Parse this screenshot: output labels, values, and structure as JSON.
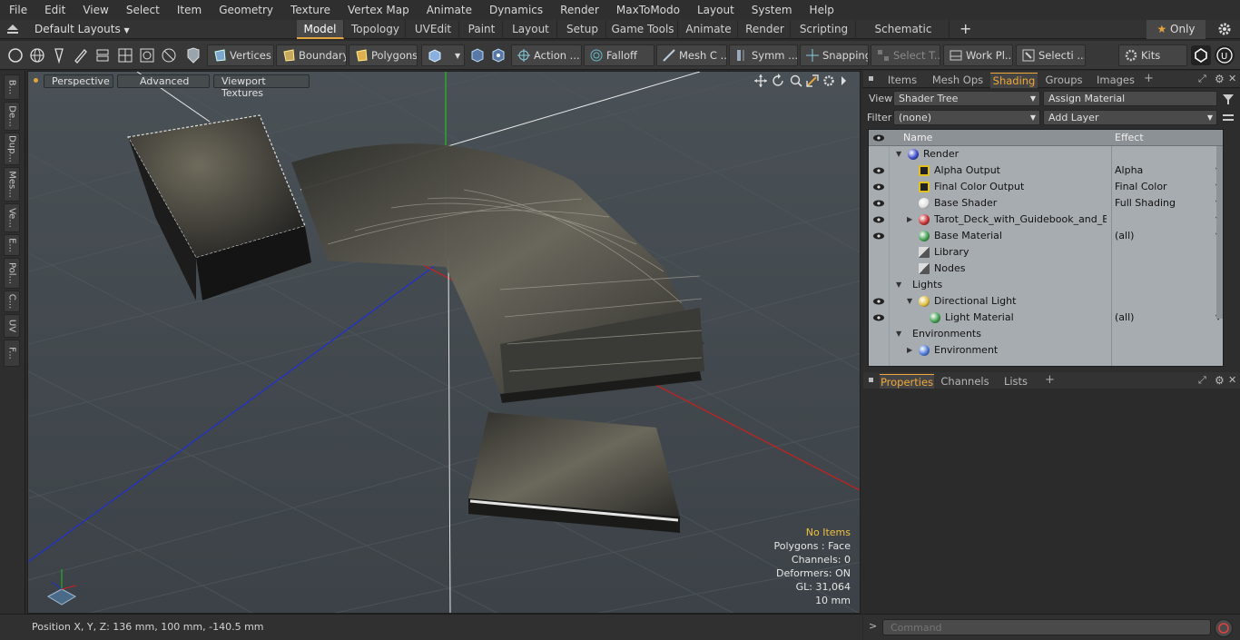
{
  "menubar": {
    "items": [
      "File",
      "Edit",
      "View",
      "Select",
      "Item",
      "Geometry",
      "Texture",
      "Vertex Map",
      "Animate",
      "Dynamics",
      "Render",
      "MaxToModo",
      "Layout",
      "System",
      "Help"
    ]
  },
  "layoutbar": {
    "layout_selector": "Default Layouts",
    "tabs": [
      "Model",
      "Topology",
      "UVEdit",
      "Paint",
      "Layout",
      "Setup",
      "Game Tools",
      "Animate",
      "Render",
      "Scripting",
      "Schematic Fusion"
    ],
    "active_tab": "Model",
    "only_label": "Only"
  },
  "toolbar": {
    "vertices": "Vertices",
    "boundary": "Boundary",
    "polygons": "Polygons",
    "action": "Action ...",
    "falloff": "Falloff",
    "meshc": "Mesh C ...",
    "symm": "Symm ...",
    "snapping": "Snapping",
    "selectt": "Select T...",
    "workpl": "Work Pl...",
    "selecti": "Selecti ...",
    "kits": "Kits"
  },
  "leftstrip": {
    "tabs": [
      "B...",
      "De...",
      "Dup...",
      "Mes...",
      "Ve...",
      "E...",
      "Pol...",
      "C...",
      "UV",
      "F..."
    ]
  },
  "viewport": {
    "perspective": "Perspective",
    "advanced": "Advanced",
    "textures": "Viewport Textures",
    "info": {
      "no_items": "No Items",
      "polygons": "Polygons : Face",
      "channels": "Channels: 0",
      "deformers": "Deformers: ON",
      "gl": "GL: 31,064",
      "scale": "10 mm"
    }
  },
  "statusbar": {
    "position": "Position X, Y, Z:   136 mm, 100 mm, -140.5 mm"
  },
  "rightpanel": {
    "tabs": [
      "Items",
      "Mesh Ops",
      "Shading",
      "Groups",
      "Images"
    ],
    "active_tab": "Shading",
    "view_label": "View",
    "view_value": "Shader Tree",
    "assign_material": "Assign Material",
    "filter_label": "Filter",
    "filter_value": "(none)",
    "add_layer": "Add Layer",
    "columns": {
      "name": "Name",
      "effect": "Effect"
    },
    "tree": [
      {
        "name": "Render",
        "effect": "",
        "depth": 0,
        "eye": false,
        "icon": "render-sphere-icon",
        "color": "#3a48c8",
        "expanded": true
      },
      {
        "name": "Alpha Output",
        "effect": "Alpha",
        "depth": 1,
        "eye": true,
        "icon": "output-icon",
        "color": "#e0c020",
        "expanded": null
      },
      {
        "name": "Final Color Output",
        "effect": "Final Color",
        "depth": 1,
        "eye": true,
        "icon": "output-icon",
        "color": "#e0c020",
        "expanded": null
      },
      {
        "name": "Base Shader",
        "effect": "Full Shading",
        "depth": 1,
        "eye": true,
        "icon": "shader-ball-icon",
        "color": "#e0e0e0",
        "expanded": null
      },
      {
        "name": "Tarot_Deck_with_Guidebook_and_B ...",
        "effect": "",
        "depth": 1,
        "eye": true,
        "icon": "material-group-icon",
        "color": "#c83030",
        "expanded": false
      },
      {
        "name": "Base Material",
        "effect": "(all)",
        "depth": 1,
        "eye": true,
        "icon": "material-ball-icon",
        "color": "#40a050",
        "expanded": null
      },
      {
        "name": "Library",
        "effect": "",
        "depth": 0.5,
        "eye": false,
        "icon": "folder-icon",
        "color": "#dddddd",
        "expanded": null
      },
      {
        "name": "Nodes",
        "effect": "",
        "depth": 0.5,
        "eye": false,
        "icon": "folder-icon",
        "color": "#dddddd",
        "expanded": null
      },
      {
        "name": "Lights",
        "effect": "",
        "depth": 0,
        "eye": false,
        "icon": "",
        "color": "",
        "expanded": true
      },
      {
        "name": "Directional Light",
        "effect": "",
        "depth": 1,
        "eye": true,
        "icon": "light-icon",
        "color": "#e0c040",
        "expanded": true
      },
      {
        "name": "Light Material",
        "effect": "(all)",
        "depth": 2,
        "eye": true,
        "icon": "material-ball-icon",
        "color": "#40a050",
        "expanded": null
      },
      {
        "name": "Environments",
        "effect": "",
        "depth": 0,
        "eye": false,
        "icon": "",
        "color": "",
        "expanded": true
      },
      {
        "name": "Environment",
        "effect": "",
        "depth": 1,
        "eye": false,
        "icon": "environment-icon",
        "color": "#4a7ad8",
        "expanded": false
      }
    ],
    "lower_tabs": [
      "Properties",
      "Channels",
      "Lists"
    ],
    "lower_active": "Properties"
  },
  "command": {
    "placeholder": "Command"
  },
  "colors": {
    "accent": "#e3a33d",
    "x_axis": "#d02020",
    "y_axis": "#20d020",
    "z_axis": "#2020d0"
  }
}
